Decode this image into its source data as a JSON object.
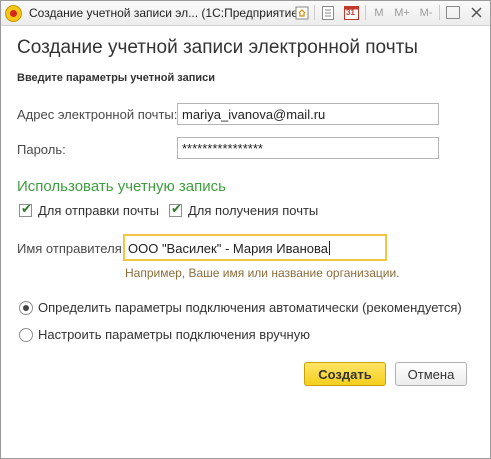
{
  "window": {
    "title": "Создание учетной записи эл...  (1С:Предприятие)",
    "toolbar": {
      "m_label": "M",
      "m_plus_label": "M+",
      "m_minus_label": "M-",
      "calendar_day": "31"
    }
  },
  "form": {
    "heading": "Создание учетной записи электронной почты",
    "section_caption": "Введите параметры учетной записи",
    "email": {
      "label": "Адрес электронной почты:",
      "value": "mariya_ivanova@mail.ru"
    },
    "password": {
      "label": "Пароль:",
      "value": "****************"
    },
    "use_account_title": "Использовать учетную запись",
    "checkboxes": [
      {
        "label": "Для отправки почты",
        "checked": true
      },
      {
        "label": "Для получения почты",
        "checked": true
      }
    ],
    "sender": {
      "label": "Имя отправителя:",
      "value": "ООО \"Василек\" - Мария Иванова",
      "hint": "Например, Ваше имя или название организации."
    },
    "connection_options": [
      {
        "label": "Определить параметры подключения автоматически (рекомендуется)",
        "selected": true
      },
      {
        "label": "Настроить параметры подключения вручную",
        "selected": false
      }
    ],
    "buttons": {
      "create": "Создать",
      "cancel": "Отмена"
    }
  },
  "colors": {
    "accent_yellow": "#f5cf1d",
    "focus_border": "#f4c542",
    "green_title": "#3d9e3d",
    "hint_text": "#8a6d3b"
  }
}
